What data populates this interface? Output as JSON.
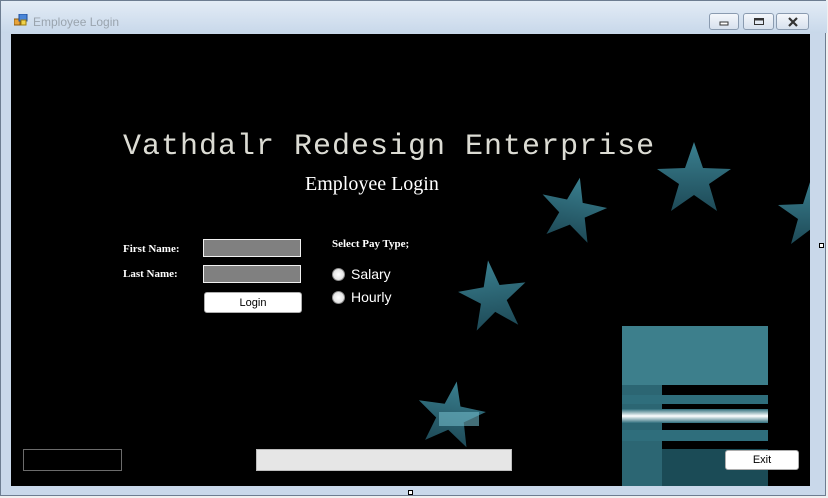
{
  "window": {
    "title": "Employee Login",
    "controls": {
      "minimize": "minimize-icon",
      "maximize": "maximize-icon",
      "close": "close-icon"
    }
  },
  "header": {
    "company": "Vathdalr Redesign Enterprise",
    "subtitle": "Employee Login"
  },
  "form": {
    "first_name_label": "First Name:",
    "first_name_value": "",
    "last_name_label": "Last Name:",
    "last_name_value": "",
    "login_label": "Login"
  },
  "pay_type": {
    "label": "Select Pay Type;",
    "options": [
      {
        "label": "Salary",
        "selected": false
      },
      {
        "label": "Hourly",
        "selected": false
      }
    ]
  },
  "footer": {
    "status_text": "",
    "progress_text": "",
    "exit_label": "Exit"
  },
  "colors": {
    "background": "#000000",
    "star": "#2a6d7c",
    "accent_glow": "#dff7ff"
  }
}
